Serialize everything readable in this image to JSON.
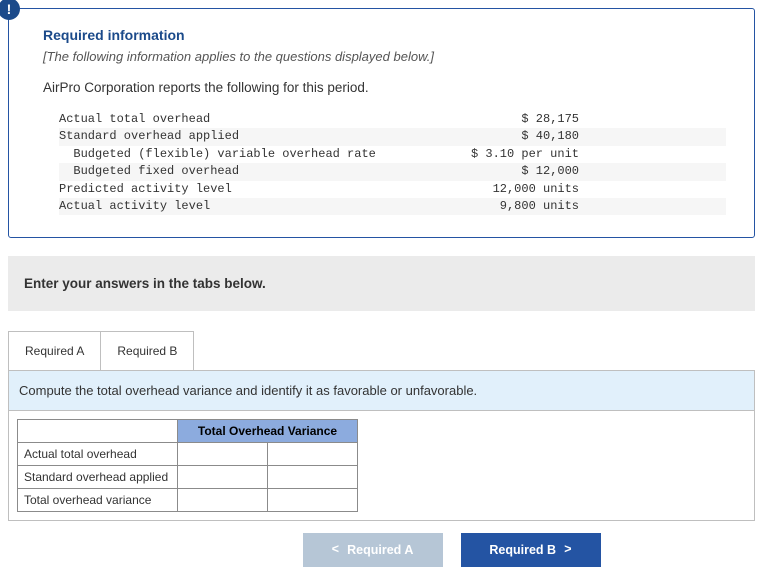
{
  "info": {
    "badge": "!",
    "heading": "Required information",
    "preamble": "[The following information applies to the questions displayed below.]",
    "intro": "AirPro Corporation reports the following for this period."
  },
  "rows": [
    {
      "label": "Actual total overhead",
      "value": "$ 28,175"
    },
    {
      "label": "Standard overhead applied",
      "value": "$ 40,180"
    },
    {
      "label": "  Budgeted (flexible) variable overhead rate",
      "value": "$ 3.10 per unit"
    },
    {
      "label": "  Budgeted fixed overhead",
      "value": "$ 12,000"
    },
    {
      "label": "Predicted activity level",
      "value": "12,000 units"
    },
    {
      "label": "Actual activity level",
      "value": "9,800 units"
    }
  ],
  "instruction": "Enter your answers in the tabs below.",
  "tabs": {
    "a": "Required A",
    "b": "Required B"
  },
  "question": "Compute the total overhead variance and identify it as favorable or unfavorable.",
  "table": {
    "header": "Total Overhead Variance",
    "r1": "Actual total overhead",
    "r2": "Standard overhead applied",
    "r3": "Total overhead variance"
  },
  "nav": {
    "prev": "Required A",
    "next": "Required B",
    "chev_left": "<",
    "chev_right": ">"
  }
}
